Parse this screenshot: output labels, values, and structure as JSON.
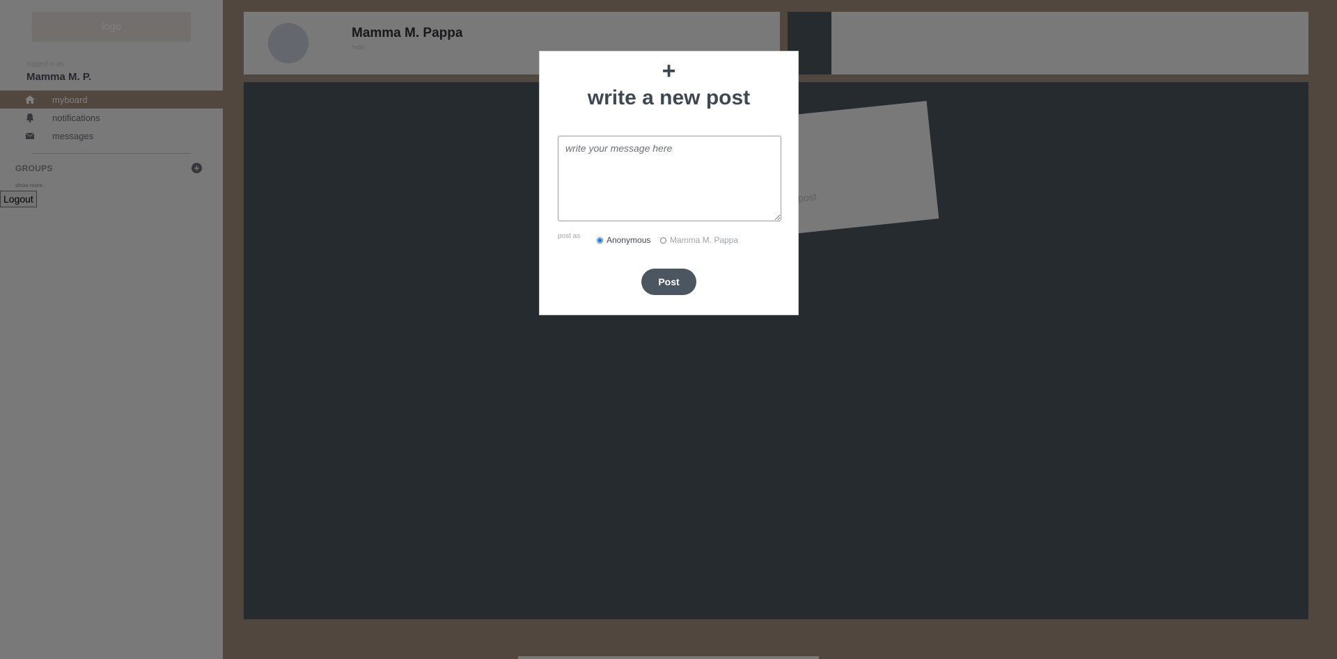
{
  "sidebar": {
    "logo": "logo",
    "logged_in_label": "logged in as",
    "user_name": "Mamma M. P.",
    "nav": [
      {
        "label": "myboard",
        "icon": "home-icon",
        "active": true
      },
      {
        "label": "notifications",
        "icon": "bell-icon",
        "active": false
      },
      {
        "label": "messages",
        "icon": "envelope-icon",
        "active": false
      }
    ],
    "groups_title": "GROUPS",
    "add_group_icon": "plus-circle-icon",
    "show_more": "show more..",
    "logout": "Logout"
  },
  "profile": {
    "name": "Mamma M. Pappa",
    "status": "hello"
  },
  "board": {
    "note_text": "post"
  },
  "modal": {
    "icon": "+",
    "title": "write a new post",
    "message_placeholder": "write your message here",
    "post_as_label": "post as",
    "options": [
      {
        "label": "Anonymous",
        "checked": true
      },
      {
        "label": "Mamma M. Pappa",
        "checked": false
      }
    ],
    "post_button": "Post"
  },
  "colors": {
    "accent": "#a58f7d",
    "board": "#4c5660",
    "sidebar": "#f2f2f2"
  }
}
